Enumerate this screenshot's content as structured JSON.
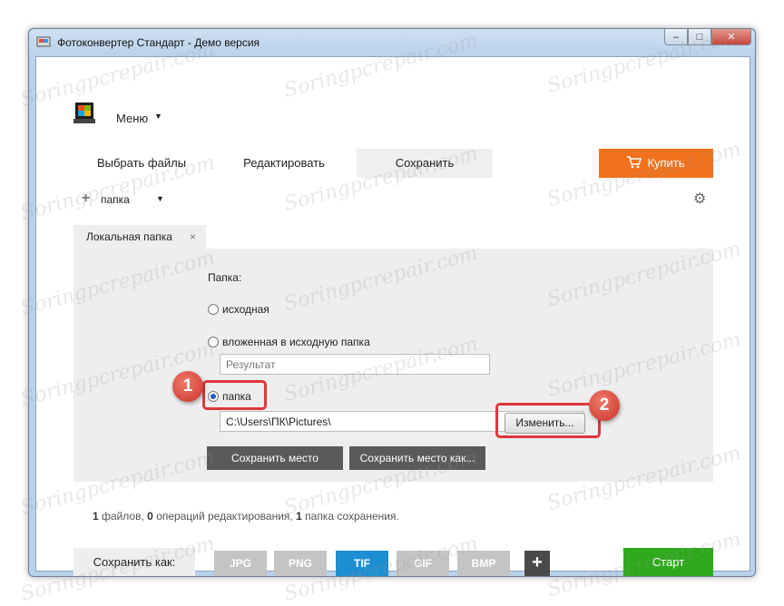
{
  "window": {
    "title": "Фотоконвертер Стандарт - Демо версия",
    "controls": {
      "minimize": "‒",
      "maximize": "□",
      "close": "✕"
    }
  },
  "menu": {
    "label": "Меню",
    "arrow": "▼"
  },
  "tabs": [
    {
      "label": "Выбрать файлы",
      "active": false
    },
    {
      "label": "Редактировать",
      "active": false
    },
    {
      "label": "Сохранить",
      "active": true
    }
  ],
  "buy_button": {
    "icon": "cart-icon",
    "label": "Купить"
  },
  "toolbar": {
    "add_icon": "+",
    "folder_label": "папка",
    "folder_arrow": "▼",
    "settings_icon": "⚙"
  },
  "subtab": {
    "label": "Локальная папка",
    "close": "×"
  },
  "folder_section": {
    "heading": "Папка:",
    "options": [
      {
        "label": "исходная",
        "checked": false
      },
      {
        "label": "вложенная в исходную папка",
        "checked": false
      },
      {
        "label": "папка",
        "checked": true
      }
    ],
    "subfolder_input_placeholder": "Результат",
    "path_input_value": "C:\\Users\\ПК\\Pictures\\",
    "change_button": "Изменить...",
    "save_location_button": "Сохранить место",
    "save_location_as_button": "Сохранить место как..."
  },
  "annotations": {
    "marker_1": "1",
    "marker_2": "2",
    "highlight_color": "#e0373a"
  },
  "summary": {
    "files_count": "1",
    "files_text": "файлов,",
    "ops_count": "0",
    "ops_text": "операций редактирования,",
    "folders_count": "1",
    "folders_text": "папка сохранения."
  },
  "save_as": {
    "label": "Сохранить как:",
    "formats": [
      {
        "label": "JPG",
        "active": false
      },
      {
        "label": "PNG",
        "active": false
      },
      {
        "label": "TIF",
        "active": true
      },
      {
        "label": "GIF",
        "active": false
      },
      {
        "label": "BMP",
        "active": false
      }
    ],
    "add_format": "+"
  },
  "start_button": "Старт",
  "watermark_text": "Soringpcrepair.com",
  "colors": {
    "accent_orange": "#f2711c",
    "start_green": "#2ea91c",
    "format_active": "#1e8ed2",
    "format_inactive": "#c4c4c4",
    "dark_button": "#5a5a5a"
  }
}
